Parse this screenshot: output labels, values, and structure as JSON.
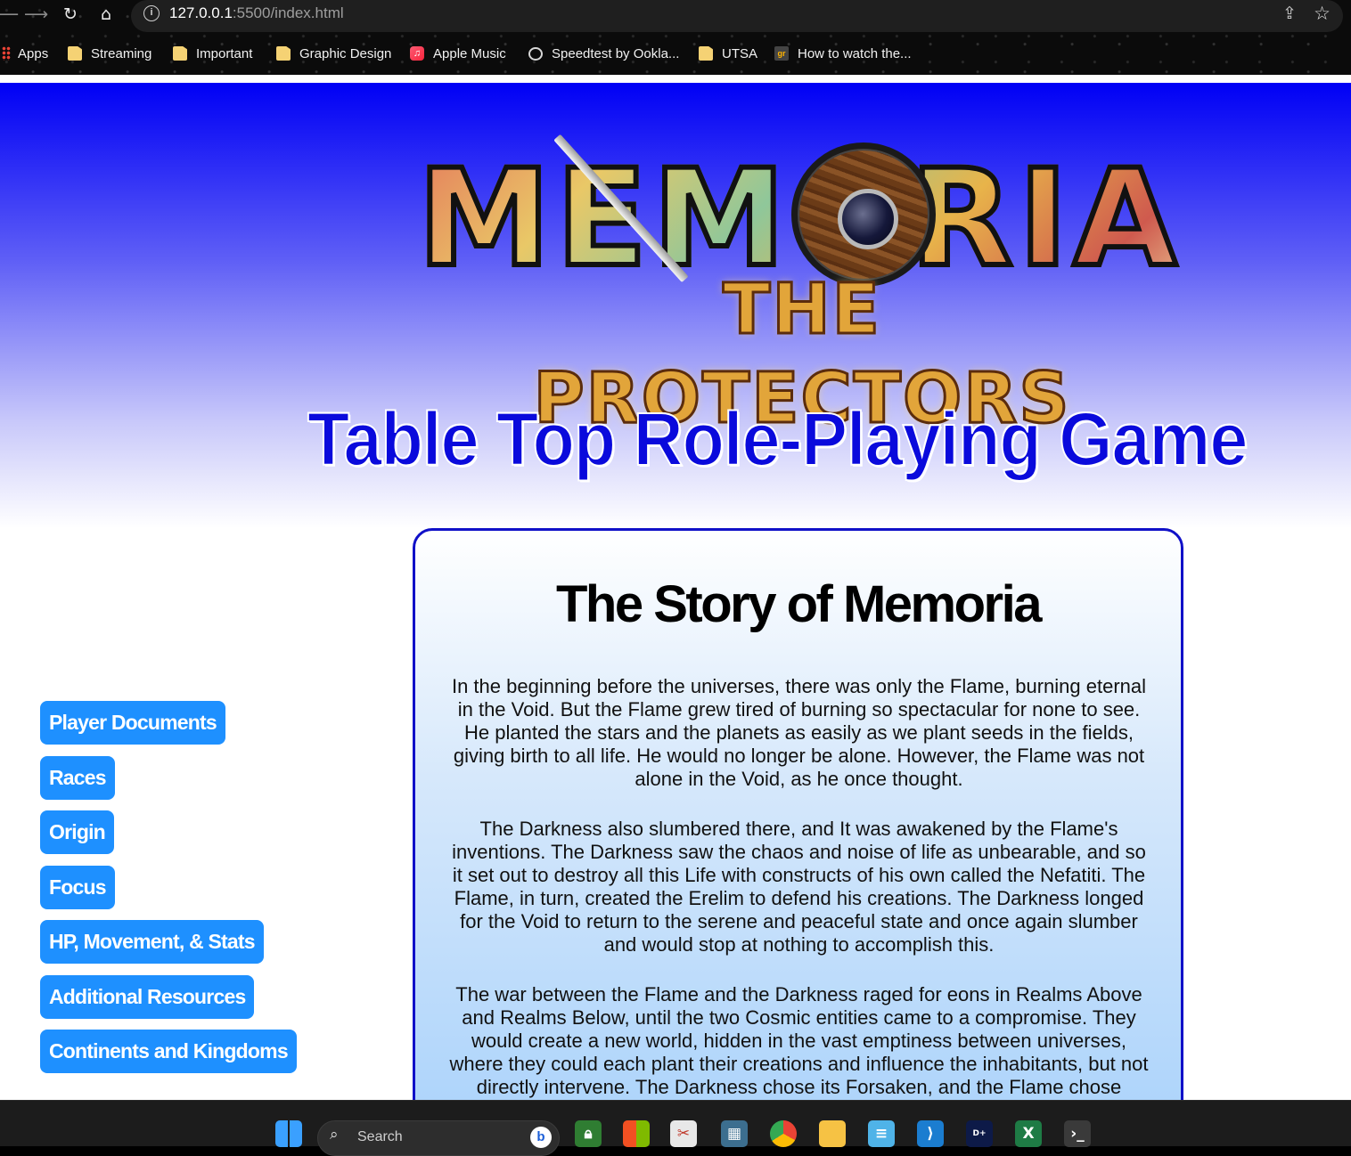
{
  "browser": {
    "url_host": "127.0.0.1",
    "url_path": ":5500/index.html",
    "bookmarks": [
      {
        "label": "Apps",
        "icon": "apps-grid-icon"
      },
      {
        "label": "Streaming",
        "icon": "folder-icon"
      },
      {
        "label": "Important",
        "icon": "folder-icon"
      },
      {
        "label": "Graphic Design",
        "icon": "folder-icon"
      },
      {
        "label": "Apple Music",
        "icon": "apple-music-icon"
      },
      {
        "label": "Speedtest by Ookla...",
        "icon": "speedtest-icon"
      },
      {
        "label": "UTSA",
        "icon": "folder-icon"
      },
      {
        "label": "How to watch the...",
        "icon": "site-favicon-icon"
      }
    ]
  },
  "header": {
    "logo_title": "MEMORIA",
    "logo_subtitle": "THE PROTECTORS",
    "tagline": "Table Top Role-Playing Game"
  },
  "sidebar": {
    "items": [
      {
        "label": "Player Documents"
      },
      {
        "label": "Races"
      },
      {
        "label": "Origin"
      },
      {
        "label": "Focus"
      },
      {
        "label": "HP, Movement, & Stats"
      },
      {
        "label": "Additional Resources"
      },
      {
        "label": "Continents and Kingdoms"
      }
    ]
  },
  "story": {
    "title": "The Story of Memoria",
    "paragraphs": [
      "In the beginning before the universes, there was only the Flame, burning eternal in the Void. But the Flame grew tired of burning so spectacular for none to see. He planted the stars and the planets as easily as we plant seeds in the fields, giving birth to all life. He would no longer be alone. However, the Flame was not alone in the Void, as he once thought.",
      "The Darkness also slumbered there, and It was awakened by the Flame's inventions. The Darkness saw the chaos and noise of life as unbearable, and so it set out to destroy all this Life with constructs of his own called the Nefatiti. The Flame, in turn, created the Erelim to defend his creations. The Darkness longed for the Void to return to the serene and peaceful state and once again slumber and would stop at nothing to accomplish this.",
      "The war between the Flame and the Darkness raged for eons in Realms Above and Realms Below, until the two Cosmic entities came to a compromise. They would create a new world, hidden in the vast emptiness between universes, where they could each plant their creations and influence the inhabitants, but not directly intervene. The Darkness chose its Forsaken, and the Flame chose"
    ]
  },
  "taskbar": {
    "search_label": "Search",
    "icons": [
      "windows-start-icon",
      "bing-icon",
      "vpn-lock-icon",
      "microsoft-store-icon",
      "snipping-tool-icon",
      "calculator-icon",
      "chrome-icon",
      "file-explorer-icon",
      "notepad-icon",
      "vscode-icon",
      "disney-plus-icon",
      "excel-icon",
      "terminal-icon"
    ]
  }
}
